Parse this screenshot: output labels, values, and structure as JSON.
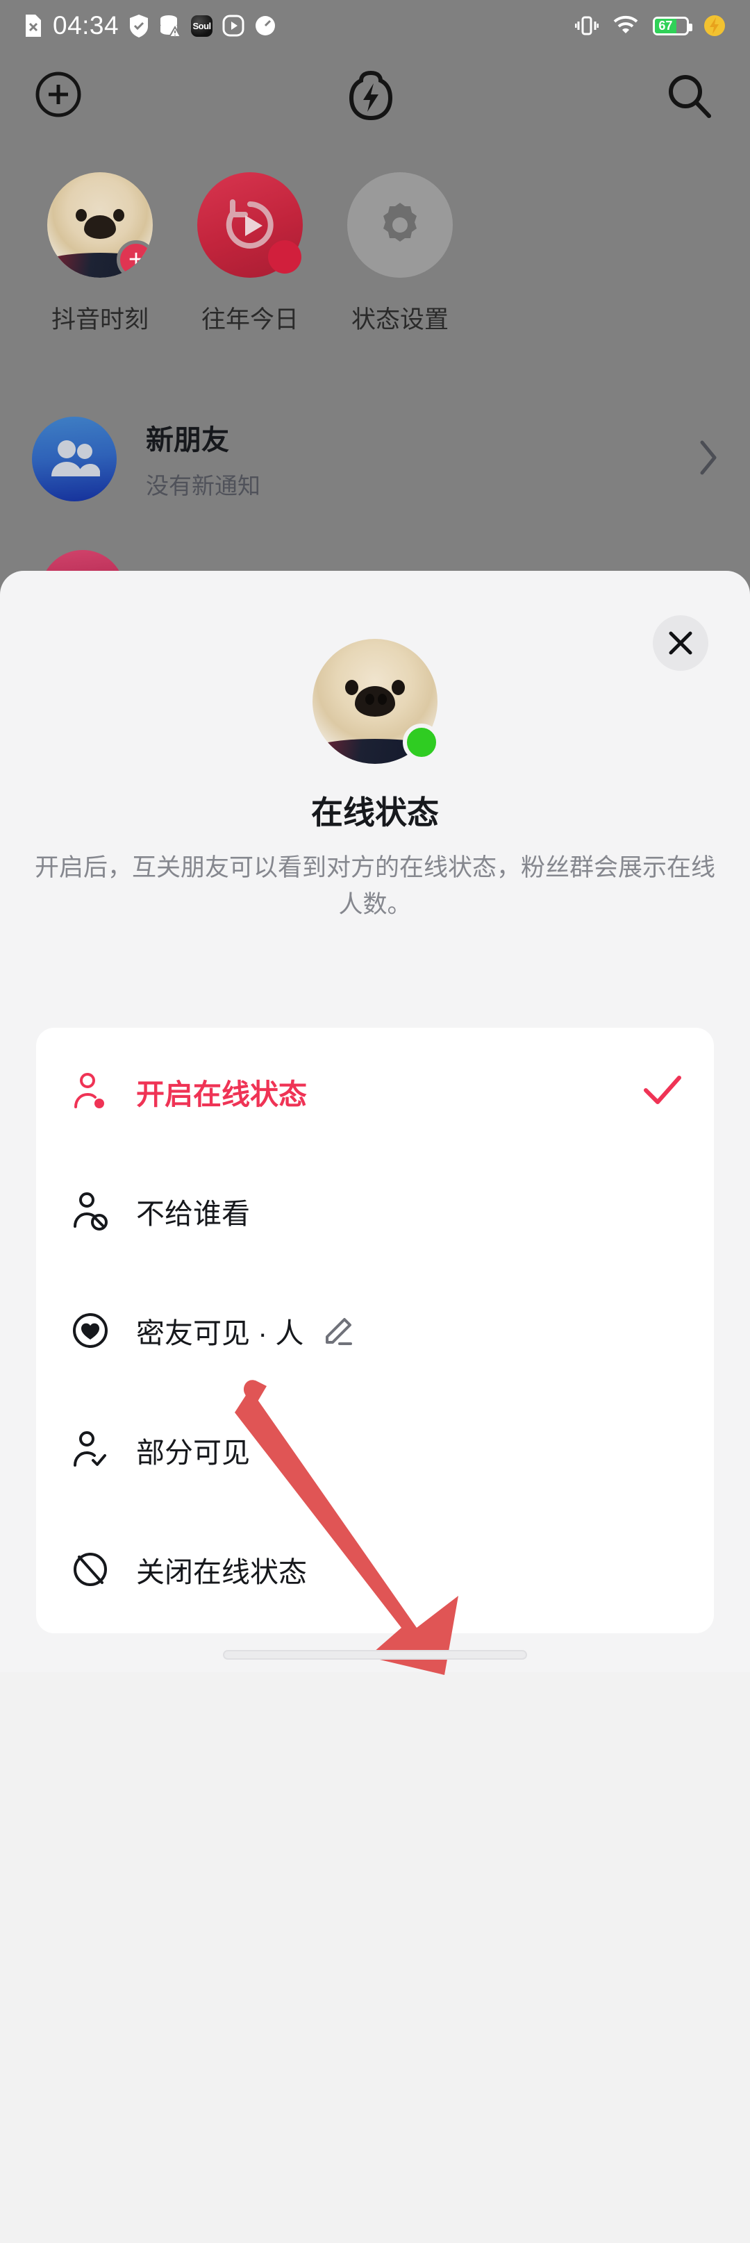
{
  "statusbar": {
    "time": "04:34",
    "battery_percent": "67",
    "left_icons": [
      "file-x-icon",
      "shield-check-icon",
      "database-warning-icon",
      "soul-app-icon",
      "play-circle-icon",
      "speedometer-icon"
    ],
    "right_icons": [
      "vibrate-icon",
      "wifi-icon",
      "battery-icon",
      "charging-bolt-icon"
    ],
    "soul_label": "Soul"
  },
  "toolbar": {
    "add_icon": "plus-circle-icon",
    "flash_icon": "flash-lightning-icon",
    "search_icon": "search-icon"
  },
  "shortcuts": [
    {
      "label": "抖音时刻",
      "icon": "avatar-with-plus-badge",
      "badge": "+"
    },
    {
      "label": "往年今日",
      "icon": "history-play-icon"
    },
    {
      "label": "状态设置",
      "icon": "gear-icon"
    }
  ],
  "new_friends": {
    "title": "新朋友",
    "subtitle": "没有新通知",
    "avatar_icon": "people-group-icon",
    "chevron_icon": "chevron-right-icon"
  },
  "sheet": {
    "close_icon": "close-icon",
    "avatar_icon": "dog-avatar",
    "status_dot": "online-green-dot",
    "title": "在线状态",
    "description": "开启后，互关朋友可以看到对方的在线状态，粉丝群会展示在线人数。",
    "options": [
      {
        "label": "开启在线状态",
        "icon": "person-online-icon",
        "selected": true,
        "check_icon": "check-icon"
      },
      {
        "label": "不给谁看",
        "icon": "person-block-icon",
        "selected": false
      },
      {
        "label": "密友可见 ·  人",
        "icon": "heart-circle-icon",
        "selected": false,
        "edit_icon": "pencil-edit-icon"
      },
      {
        "label": "部分可见",
        "icon": "person-check-icon",
        "selected": false
      },
      {
        "label": "关闭在线状态",
        "icon": "slash-circle-icon",
        "selected": false
      }
    ]
  },
  "annotation": {
    "arrow_icon": "pointer-arrow-icon",
    "color": "#e05555"
  },
  "colors": {
    "accent_red": "#ef3355",
    "online_green": "#2fcc22",
    "sheet_bg": "#f4f4f5",
    "card_bg": "#ffffff",
    "scrim": "#808080"
  },
  "home_indicator": "home-indicator"
}
